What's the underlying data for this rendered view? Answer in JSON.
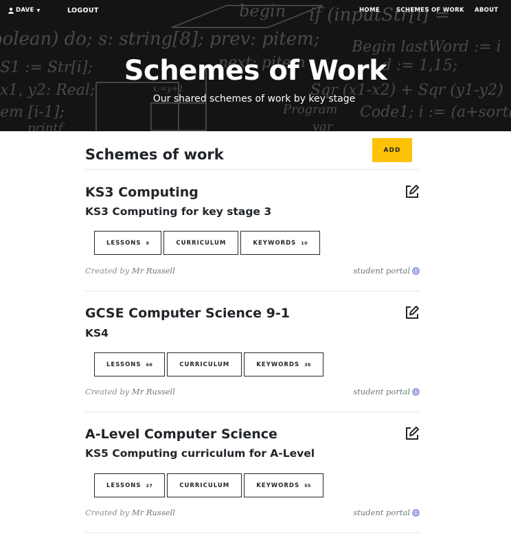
{
  "nav": {
    "user_label": "DAVE",
    "logout_label": "LOGOUT",
    "home_label": "HOME",
    "schemes_label": "SCHEMES OF WORK",
    "about_label": "ABOUT"
  },
  "hero": {
    "title": "Schemes of Work",
    "subtitle": "Our shared schemes of work by key stage",
    "chalk": [
      "begin",
      "if (inputStr[i] =",
      "oolean) do; s: string[8]; prev: pitem;",
      "Begin lastWord := i",
      "S1 := Str[i];",
      "next: pitem",
      "d := 1,15;",
      "x1, y2: Real;",
      "x:=y+1",
      "Sqr (x1-x2) + Sqr (y1-y2)",
      "em [i-1];",
      "Program",
      "Code1; i := (a+sort(a",
      "var",
      "printf"
    ]
  },
  "page": {
    "title": "Schemes of work",
    "add_label": "ADD"
  },
  "labels": {
    "lessons": "LESSONS",
    "curriculum": "CURRICULUM",
    "keywords": "KEYWORDS",
    "created_by": "Created by",
    "student_portal": "student portal"
  },
  "schemes": [
    {
      "name": "KS3 Computing",
      "description": "KS3 Computing for key stage 3",
      "lessons": "9",
      "keywords": "10",
      "author": "Mr Russell"
    },
    {
      "name": "GCSE Computer Science 9-1",
      "description": "KS4",
      "lessons": "66",
      "keywords": "38",
      "author": "Mr Russell"
    },
    {
      "name": "A-Level Computer Science",
      "description": "KS5 Computing curriculum for A-Level",
      "lessons": "27",
      "keywords": "55",
      "author": "Mr Russell"
    }
  ],
  "colors": {
    "accent": "#fec107",
    "header_bg": "#141414",
    "globe": "#6f7fd8"
  },
  "icons": {
    "user": "user-icon",
    "edit": "edit-icon",
    "globe": "globe-icon"
  }
}
